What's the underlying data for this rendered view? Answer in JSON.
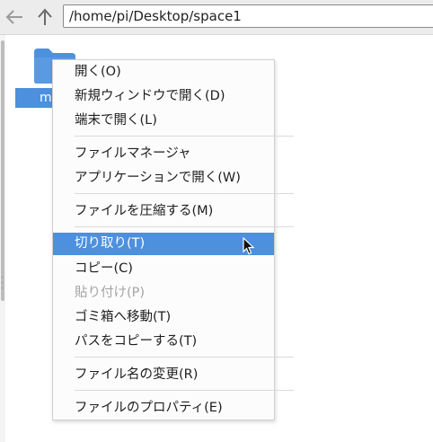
{
  "toolbar": {
    "back_icon": "back-arrow-icon",
    "up_icon": "up-arrow-icon",
    "address": "/home/pi/Desktop/space1"
  },
  "desktop": {
    "folder": {
      "label": "m",
      "icon": "folder-icon"
    }
  },
  "context_menu": {
    "items": [
      {
        "label": "開く(O)",
        "enabled": true
      },
      {
        "label": "新規ウィンドウで開く(D)",
        "enabled": true
      },
      {
        "label": "端末で開く(L)",
        "enabled": true
      },
      {
        "label": "ファイルマネージャ",
        "enabled": true
      },
      {
        "label": "アプリケーションで開く(W)",
        "enabled": true
      },
      {
        "label": "ファイルを圧縮する(M)",
        "enabled": true
      },
      {
        "label": "切り取り(T)",
        "enabled": true,
        "highlighted": true
      },
      {
        "label": "コピー(C)",
        "enabled": true
      },
      {
        "label": "貼り付け(P)",
        "enabled": false
      },
      {
        "label": "ゴミ箱へ移動(T)",
        "enabled": true
      },
      {
        "label": "パスをコピーする(T)",
        "enabled": true
      },
      {
        "label": "ファイル名の変更(R)",
        "enabled": true
      },
      {
        "label": "ファイルのプロパティ(E)",
        "enabled": true
      }
    ]
  },
  "colors": {
    "highlight": "#4d90dd",
    "folder": "#4d90dd",
    "disabled_text": "#a4a4a4"
  }
}
